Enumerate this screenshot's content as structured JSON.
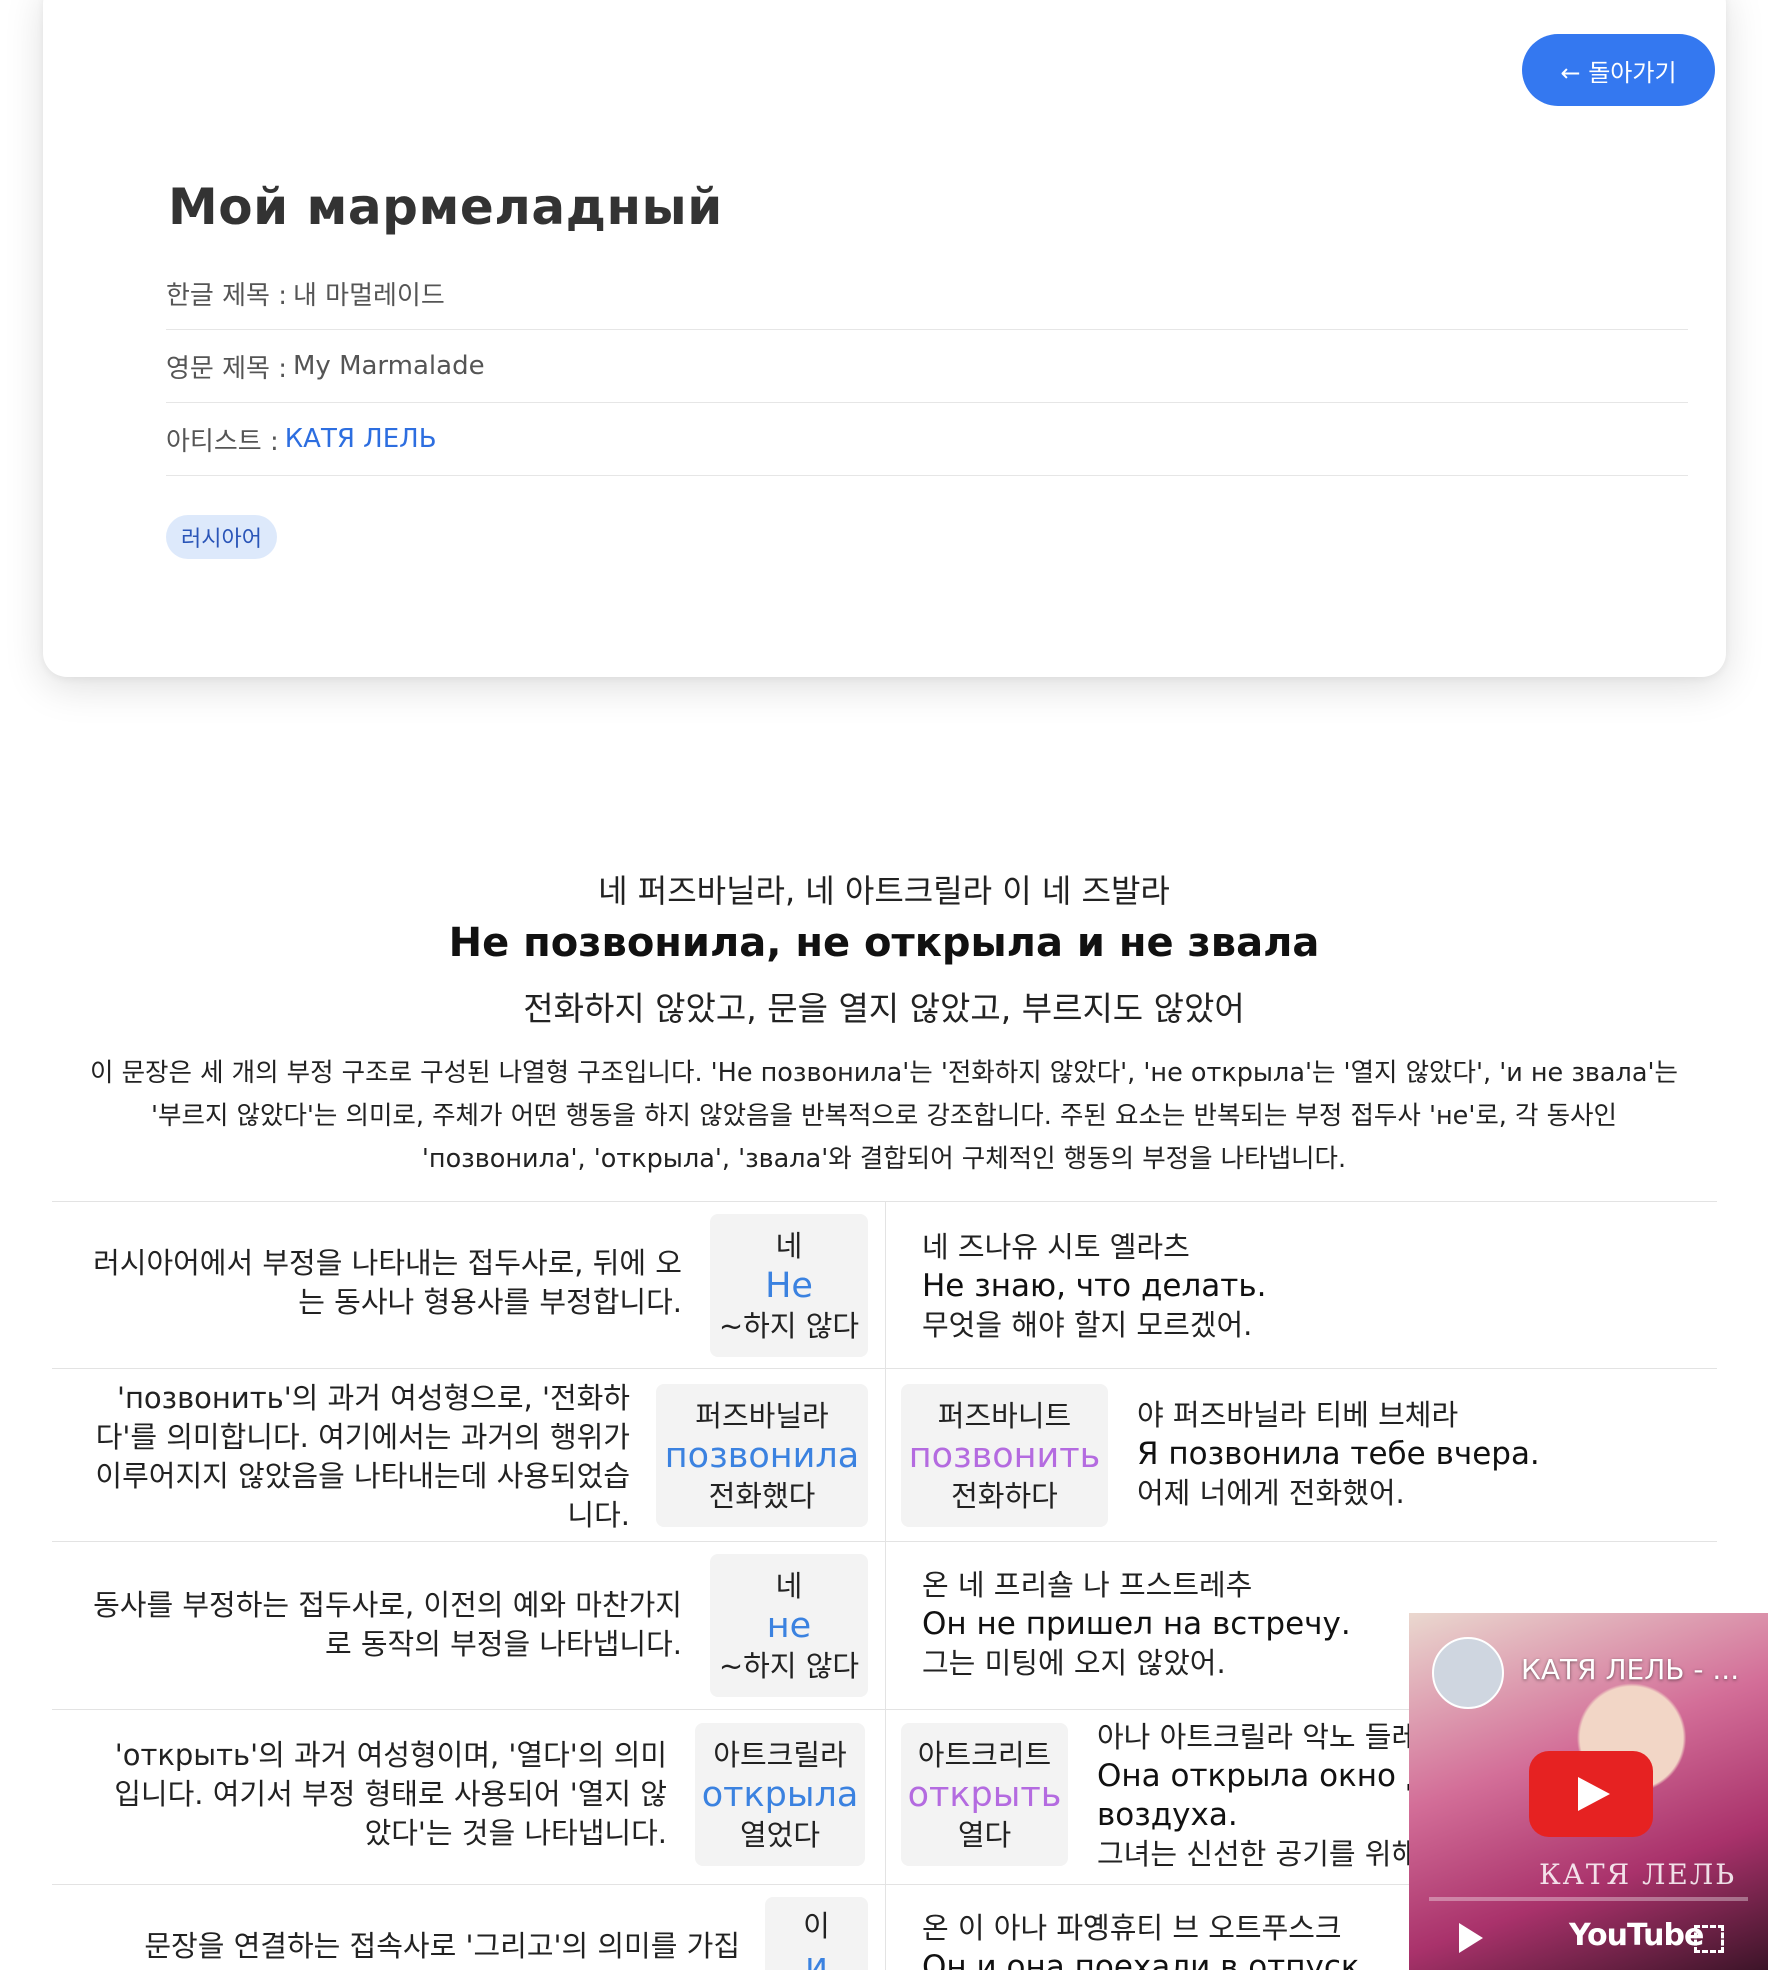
{
  "header": {
    "back_label": "← 돌아가기",
    "title": "Мой мармеладный",
    "meta": [
      {
        "key": "한글 제목 :",
        "value": "내 마멀레이드"
      },
      {
        "key": "영문 제목 :",
        "value": "My Marmalade"
      },
      {
        "key": "아티스트 :",
        "value": "КАТЯ ЛЕЛЬ"
      }
    ],
    "language_tag": "러시아어",
    "colors": {
      "accent": "#3478f0",
      "link": "#2d6ee0",
      "tag_bg": "#dde9fb"
    }
  },
  "lyric": {
    "pronunciation": "네 퍼즈바닐라, 네 아트크릴라 이 네 즈발라",
    "original": "Не позвонила, не открыла и не звала",
    "translation": "전화하지 않았고, 문을 열지 않았고, 부르지도 않았어",
    "explanation": "이 문장은 세 개의 부정 구조로 구성된 나열형 구조입니다. 'Не позвонила'는 '전화하지 않았다', 'не открыла'는 '열지 않았다', 'и не звала'는 '부르지 않았다'는 의미로, 주체가 어떤 행동을 하지 않았음을 반복적으로 강조합니다. 주된 요소는 반복되는 부정 접두사 'не'로, 각 동사인 'позвонила', 'открыла', 'звала'와 결합되어 구체적인 행동의 부정을 나타냅니다."
  },
  "words": [
    {
      "explanation": "러시아어에서 부정을 나타내는 접두사로, 뒤에 오는 동사나 형용사를 부정합니다.",
      "word": {
        "pron": "네",
        "text": "Не",
        "meaning": "~하지 않다"
      },
      "example": {
        "pron": "네 즈나유 시토 옐라츠",
        "orig": "Не знаю, что делать.",
        "trans": "무엇을 해야 할지 모르겠어."
      }
    },
    {
      "explanation": "'позвонить'의 과거 여성형으로, '전화하다'를 의미합니다. 여기에서는 과거의 행위가 이루어지지 않았음을 나타내는데 사용되었습니다.",
      "word": {
        "pron": "퍼즈바닐라",
        "text": "позвонила",
        "meaning": "전화했다"
      },
      "infinitive": {
        "pron": "퍼즈바니트",
        "text": "позвонить",
        "meaning": "전화하다"
      },
      "example": {
        "pron": "야 퍼즈바닐라 티베 브체라",
        "orig": "Я позвонила тебе вчера.",
        "trans": "어제 너에게 전화했어."
      }
    },
    {
      "explanation": "동사를 부정하는 접두사로, 이전의 예와 마찬가지로 동작의 부정을 나타냅니다.",
      "word": {
        "pron": "네",
        "text": "не",
        "meaning": "~하지 않다"
      },
      "example": {
        "pron": "온 네 프리숄 나 프스트레추",
        "orig": "Он не пришел на встречу.",
        "trans": "그는 미팅에 오지 않았어."
      }
    },
    {
      "explanation": "'открыть'의 과거 여성형이며, '열다'의 의미입니다. 여기서 부정 형태로 사용되어 '열지 않았다'는 것을 나타냅니다.",
      "word": {
        "pron": "아트크릴라",
        "text": "открыла",
        "meaning": "열었다"
      },
      "infinitive": {
        "pron": "아트크리트",
        "text": "открыть",
        "meaning": "열다"
      },
      "example": {
        "pron": "아나 아트크릴라 악노 들레",
        "orig": "Она открыла окно для свежего воздуха.",
        "trans": "그녀는 신선한 공기를 위해"
      }
    },
    {
      "explanation": "문장을 연결하는 접속사로 '그리고'의 의미를 가집",
      "word": {
        "pron": "이",
        "text": "и",
        "meaning": ""
      },
      "example": {
        "pron": "온 이 아나 파옝휴티 브 오트푸스크",
        "orig": "Он и она поехали в отпуск.",
        "trans": ""
      }
    }
  ],
  "video": {
    "title": "КАТЯ ЛЕЛЬ - ...",
    "brand": "YouTube",
    "watermark": "КАТЯ ЛЕЛЬ"
  }
}
